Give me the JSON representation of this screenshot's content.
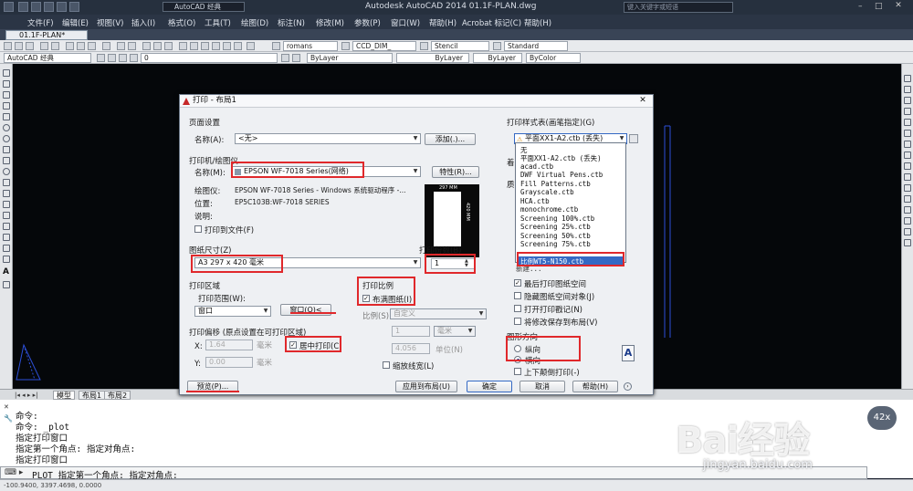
{
  "window": {
    "title": "Autodesk AutoCAD 2014   01.1F-PLAN.dwg",
    "workspace": "AutoCAD 经典",
    "search_placeholder": "键入关键字或短语"
  },
  "menu": [
    "文件(F)",
    "编辑(E)",
    "视图(V)",
    "插入(I)",
    "格式(O)",
    "工具(T)",
    "绘图(D)",
    "标注(N)",
    "修改(M)",
    "参数(P)",
    "窗口(W)",
    "帮助(H)",
    "Acrobat 标记(C)",
    "帮助(H)"
  ],
  "doc_tab": "01.1F-PLAN*",
  "toolbar": {
    "workspace": "AutoCAD 经典",
    "layer": "0",
    "font": "romans",
    "dimstyle": "CCD_DIM_",
    "textstyle": "Stencil",
    "tablestyle": "Standard",
    "color": "ByLayer",
    "linetype": "ByLayer",
    "lineweight": "ByLayer",
    "plotstyle": "ByColor"
  },
  "layout_tabs": [
    "模型",
    "布局1",
    "布局2"
  ],
  "command_lines": [
    "命令:",
    "命令: _plot",
    "指定打印窗口",
    "指定第一个角点: 指定对角点:",
    "指定打印窗口"
  ],
  "command_prompt": "PLOT 指定第一个角点: 指定对角点:",
  "status": "-100.9400, 3397.4698, 0.0000",
  "zoom_badge": "42x",
  "watermark": {
    "brand": "Bai经验",
    "url": "jingyan.baidu.com"
  },
  "dialog": {
    "title": "打印 - 布局1",
    "page_setup": {
      "group": "页面设置",
      "name_label": "名称(A):",
      "name_value": "<无>",
      "add_button": "添加(.)..."
    },
    "printer": {
      "group": "打印机/绘图仪",
      "name_label": "名称(M):",
      "name_value": "EPSON WF-7018 Series(网络)",
      "properties_button": "特性(R)...",
      "plotter_label": "绘图仪:",
      "plotter_value": "EPSON WF-7018 Series - Windows 系统驱动程序 -...",
      "location_label": "位置:",
      "location_value": "EP5C103B:WF-7018 SERIES",
      "desc_label": "说明:",
      "plot_to_file": "打印到文件(F)",
      "preview_dim_w": "297 MM",
      "preview_dim_h": "420 MM"
    },
    "paper_size": {
      "group": "图纸尺寸(Z)",
      "value": "A3 297 x 420 毫米"
    },
    "copies": {
      "group": "打印份数(B)",
      "value": "1"
    },
    "plot_area": {
      "group": "打印区域",
      "range_label": "打印范围(W):",
      "range_value": "窗口",
      "window_button": "窗口(O)<"
    },
    "plot_offset": {
      "group": "打印偏移 (原点设置在可打印区域)",
      "x_label": "X:",
      "x_value": "1.64",
      "x_unit": "毫米",
      "y_label": "Y:",
      "y_value": "0.00",
      "y_unit": "毫米",
      "center": "居中打印(C)"
    },
    "plot_scale": {
      "group": "打印比例",
      "fit": "布满图纸(I)",
      "scale_label": "比例(S):",
      "scale_value": "自定义",
      "num": "1",
      "unit": "毫米",
      "den": "4.056",
      "den_unit": "单位(N)",
      "lineweights": "缩放线宽(L)"
    },
    "plot_style_table": {
      "group": "打印样式表(画笔指定)(G)",
      "value": "平面XX1-A2.ctb (丢失)",
      "items": [
        "无",
        "平面XX1-A2.ctb (丢失)",
        "acad.ctb",
        "DWF Virtual Pens.ctb",
        "Fill Patterns.ctb",
        "Grayscale.ctb",
        "HCA.ctb",
        "monochrome.ctb",
        "Screening 100%.ctb",
        "Screening 25%.ctb",
        "Screening 50%.ctb",
        "Screening 75%.ctb",
        "新建...",
        "比例WT5-N150.ctb",
        "新建..."
      ]
    },
    "options": [
      "最后打印图纸空间",
      "隐藏图纸空间对象(J)",
      "打开打印戳记(N)",
      "将修改保存到布局(V)"
    ],
    "orientation": {
      "group": "图形方向",
      "portrait": "纵向",
      "landscape": "横向",
      "upside_down": "上下颠倒打印(-)"
    },
    "buttons": {
      "preview": "预览(P)...",
      "apply": "应用到布局(U)",
      "ok": "确定",
      "cancel": "取消",
      "help": "帮助(H)"
    },
    "shade_label": "着",
    "quality_label": "质"
  }
}
